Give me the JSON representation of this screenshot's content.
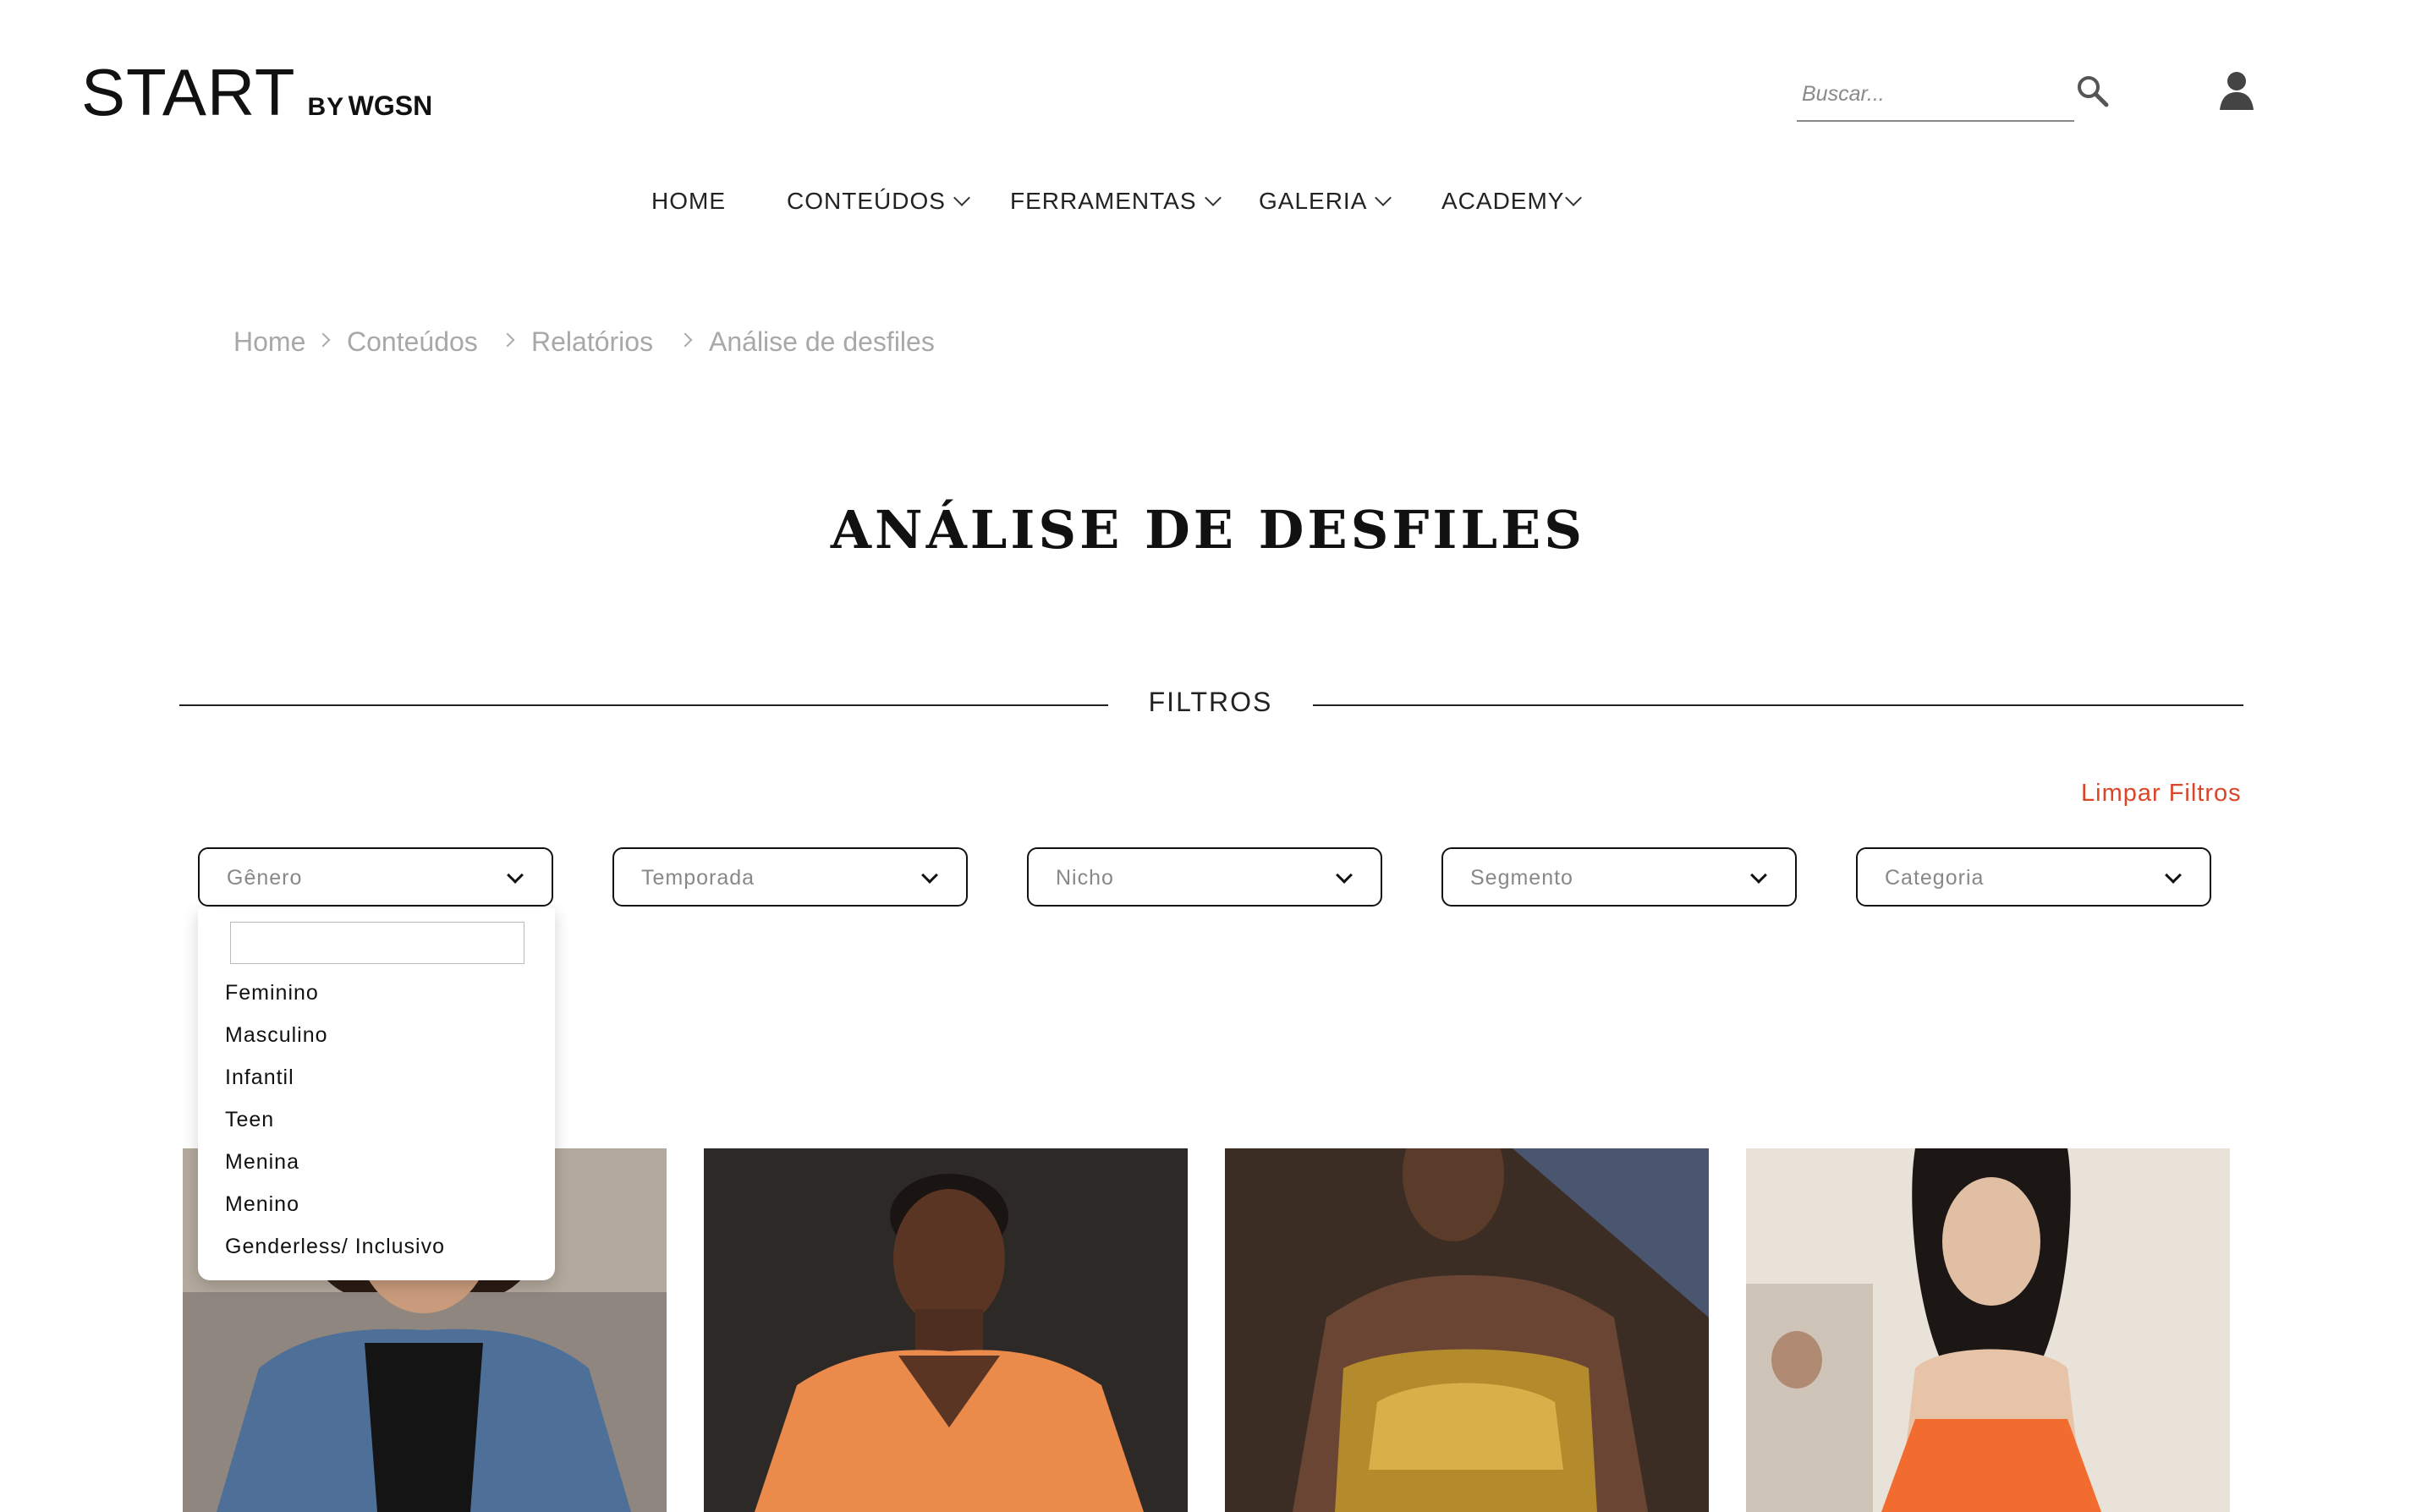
{
  "header": {
    "logo": {
      "main": "START",
      "by": "BY",
      "brand": "WGSN"
    },
    "search": {
      "placeholder": "Buscar..."
    }
  },
  "nav": {
    "items": [
      {
        "label": "HOME",
        "has_dropdown": false
      },
      {
        "label": "CONTEÚDOS",
        "has_dropdown": true
      },
      {
        "label": "FERRAMENTAS",
        "has_dropdown": true
      },
      {
        "label": "GALERIA",
        "has_dropdown": true
      },
      {
        "label": "ACADEMY",
        "has_dropdown": true
      }
    ]
  },
  "breadcrumb": [
    "Home",
    "Conteúdos",
    "Relatórios",
    "Análise de desfiles"
  ],
  "page": {
    "title": "ANÁLISE DE DESFILES",
    "filters_heading": "FILTROS",
    "clear_filters": "Limpar Filtros"
  },
  "filters": [
    {
      "label": "Gênero",
      "open": true
    },
    {
      "label": "Temporada",
      "open": false
    },
    {
      "label": "Nicho",
      "open": false
    },
    {
      "label": "Segmento",
      "open": false
    },
    {
      "label": "Categoria",
      "open": false
    }
  ],
  "genero_dropdown": {
    "search_value": "",
    "options": [
      "Feminino",
      "Masculino",
      "Infantil",
      "Teen",
      "Menina",
      "Menino",
      "Genderless/ Inclusivo"
    ]
  },
  "cards": [
    {
      "name": "runway-photo-denim-jacket",
      "colors": {
        "bg": "#8a8078",
        "accent": "#3f5f86"
      }
    },
    {
      "name": "runway-photo-orange-knit",
      "colors": {
        "bg": "#2a2624",
        "accent": "#e8894a"
      }
    },
    {
      "name": "runway-photo-gold-bustier",
      "colors": {
        "bg": "#3a2c22",
        "accent": "#b8912e"
      }
    },
    {
      "name": "runway-photo-orange-dress",
      "colors": {
        "bg": "#e9e3da",
        "accent": "#f06a2f"
      }
    }
  ],
  "colors": {
    "accent_red": "#d9472b"
  }
}
